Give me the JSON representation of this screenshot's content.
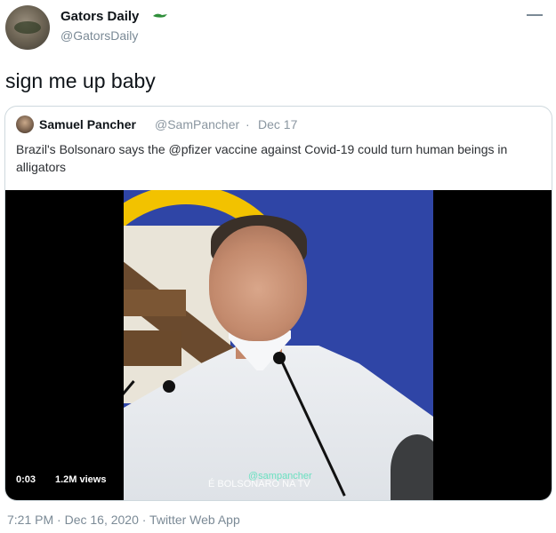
{
  "tweet": {
    "display_name": "Gators Daily",
    "handle": "@GatorsDaily",
    "text": "sign me up baby",
    "footer": "7:21 PM · Dec 16, 2020 · Twitter Web App"
  },
  "quoted": {
    "display_name": "Samuel Pancher",
    "handle": "@SamPancher",
    "separator": "·",
    "date": "Dec 17",
    "text": "Brazil's Bolsonaro says the @pfizer vaccine against Covid-19 could turn human beings in alligators",
    "video": {
      "time": "0:03",
      "views": "1.2M views",
      "watermark": "@sampancher",
      "caption": "É BOLSONARO NA TV"
    }
  },
  "icons": {
    "verified_badge": "gator-icon",
    "more": "more-icon"
  },
  "colors": {
    "secondary_text": "#7b8a96",
    "border": "#cfd9de",
    "video_bg": "#000000"
  }
}
